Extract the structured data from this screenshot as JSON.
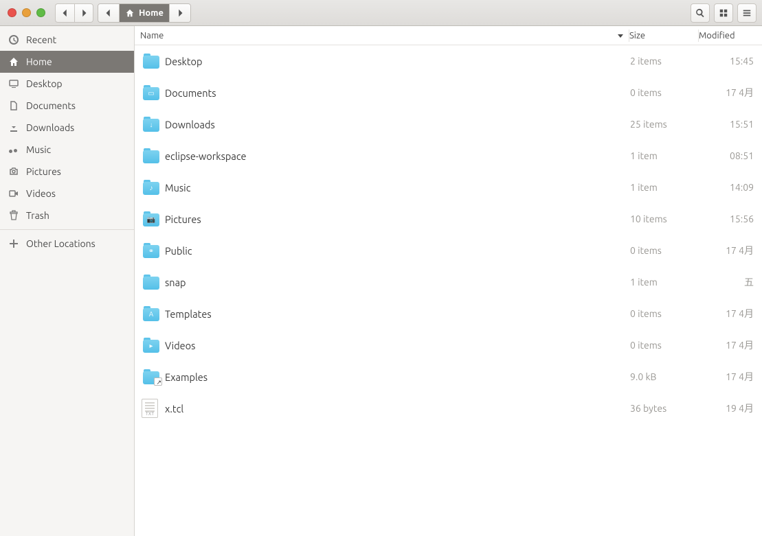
{
  "toolbar": {
    "path_current": "Home"
  },
  "sidebar": {
    "items": [
      {
        "label": "Recent",
        "icon": "clock"
      },
      {
        "label": "Home",
        "icon": "home",
        "active": true
      },
      {
        "label": "Desktop",
        "icon": "desktop"
      },
      {
        "label": "Documents",
        "icon": "documents"
      },
      {
        "label": "Downloads",
        "icon": "download"
      },
      {
        "label": "Music",
        "icon": "music"
      },
      {
        "label": "Pictures",
        "icon": "camera"
      },
      {
        "label": "Videos",
        "icon": "video"
      },
      {
        "label": "Trash",
        "icon": "trash"
      }
    ],
    "other_locations": "Other Locations"
  },
  "columns": {
    "name": "Name",
    "size": "Size",
    "modified": "Modified"
  },
  "rows": [
    {
      "name": "Desktop",
      "size": "2 items",
      "modified": "15:45",
      "type": "folder",
      "glyph": ""
    },
    {
      "name": "Documents",
      "size": "0 items",
      "modified": "17 4月",
      "type": "folder",
      "glyph": "▭"
    },
    {
      "name": "Downloads",
      "size": "25 items",
      "modified": "15:51",
      "type": "folder",
      "glyph": "↓"
    },
    {
      "name": "eclipse-workspace",
      "size": "1 item",
      "modified": "08:51",
      "type": "folder",
      "glyph": ""
    },
    {
      "name": "Music",
      "size": "1 item",
      "modified": "14:09",
      "type": "folder",
      "glyph": "♪"
    },
    {
      "name": "Pictures",
      "size": "10 items",
      "modified": "15:56",
      "type": "folder",
      "glyph": "📷"
    },
    {
      "name": "Public",
      "size": "0 items",
      "modified": "17 4月",
      "type": "folder",
      "glyph": "⚭"
    },
    {
      "name": "snap",
      "size": "1 item",
      "modified": "五",
      "type": "folder",
      "glyph": ""
    },
    {
      "name": "Templates",
      "size": "0 items",
      "modified": "17 4月",
      "type": "folder",
      "glyph": "A"
    },
    {
      "name": "Videos",
      "size": "0 items",
      "modified": "17 4月",
      "type": "folder",
      "glyph": "▸"
    },
    {
      "name": "Examples",
      "size": "9.0 kB",
      "modified": "17 4月",
      "type": "folder-link",
      "glyph": ""
    },
    {
      "name": "x.tcl",
      "size": "36 bytes",
      "modified": "19 4月",
      "type": "txt",
      "glyph": ""
    }
  ]
}
